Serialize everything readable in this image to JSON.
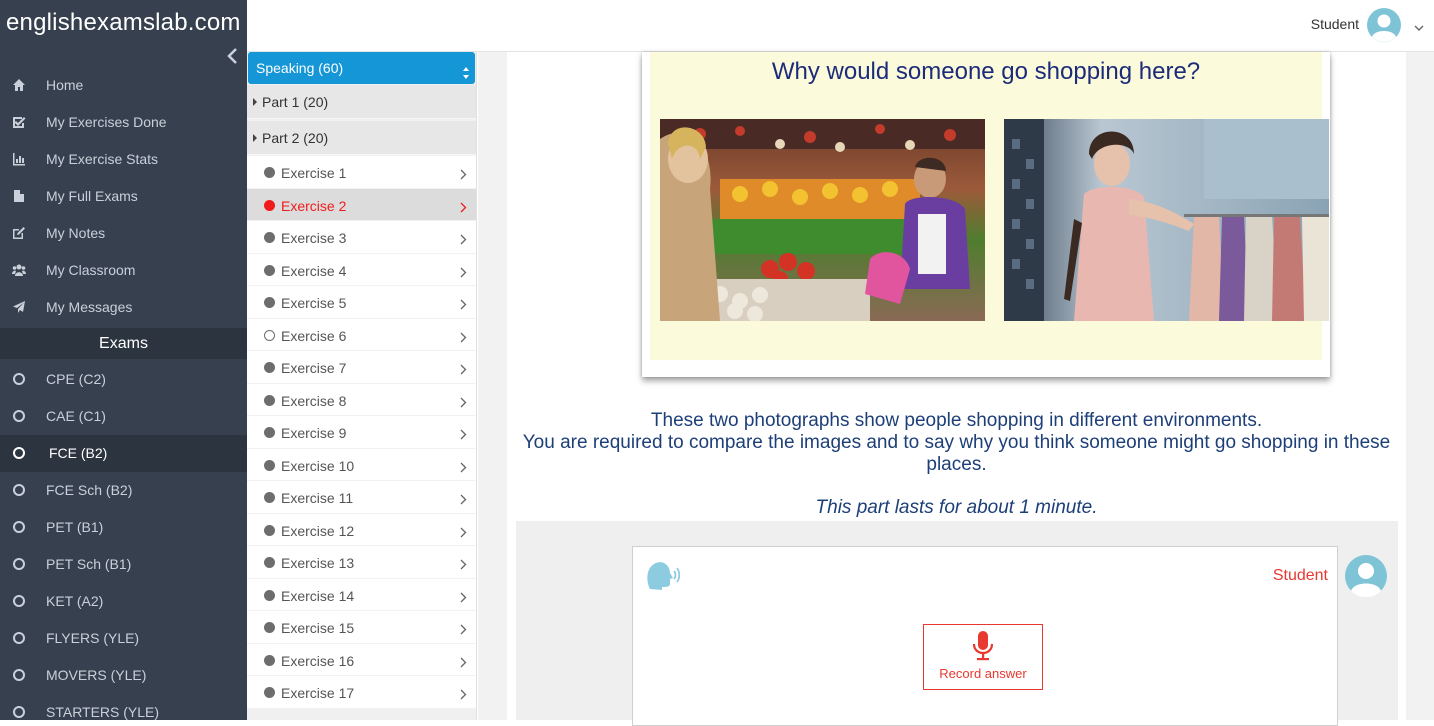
{
  "brand": {
    "logo_text": "englishexamslab.com"
  },
  "header": {
    "user_name": "Student"
  },
  "sidebar": {
    "items": [
      {
        "label": "Home",
        "icon": "home-icon"
      },
      {
        "label": "My Exercises Done",
        "icon": "check-square-icon"
      },
      {
        "label": "My Exercise Stats",
        "icon": "bar-chart-icon"
      },
      {
        "label": "My Full Exams",
        "icon": "file-icon"
      },
      {
        "label": "My Notes",
        "icon": "edit-icon"
      },
      {
        "label": "My Classroom",
        "icon": "users-icon"
      },
      {
        "label": "My Messages",
        "icon": "paper-plane-icon"
      }
    ],
    "exams_heading": "Exams",
    "exams": [
      {
        "label": "CPE (C2)",
        "active": false
      },
      {
        "label": "CAE (C1)",
        "active": false
      },
      {
        "label": "FCE (B2)",
        "active": true
      },
      {
        "label": "FCE Sch (B2)",
        "active": false
      },
      {
        "label": "PET (B1)",
        "active": false
      },
      {
        "label": "PET Sch (B1)",
        "active": false
      },
      {
        "label": "KET (A2)",
        "active": false
      },
      {
        "label": "FLYERS (YLE)",
        "active": false
      },
      {
        "label": "MOVERS (YLE)",
        "active": false
      },
      {
        "label": "STARTERS (YLE)",
        "active": false
      }
    ]
  },
  "panel": {
    "section_select": "Speaking (60)",
    "parts": [
      "Part 1 (20)",
      "Part 2 (20)"
    ],
    "exercises": [
      {
        "label": "Exercise 1",
        "status": "done",
        "active": false
      },
      {
        "label": "Exercise 2",
        "status": "current",
        "active": true
      },
      {
        "label": "Exercise 3",
        "status": "done",
        "active": false
      },
      {
        "label": "Exercise 4",
        "status": "done",
        "active": false
      },
      {
        "label": "Exercise 5",
        "status": "done",
        "active": false
      },
      {
        "label": "Exercise 6",
        "status": "empty",
        "active": false
      },
      {
        "label": "Exercise 7",
        "status": "done",
        "active": false
      },
      {
        "label": "Exercise 8",
        "status": "done",
        "active": false
      },
      {
        "label": "Exercise 9",
        "status": "done",
        "active": false
      },
      {
        "label": "Exercise 10",
        "status": "done",
        "active": false
      },
      {
        "label": "Exercise 11",
        "status": "done",
        "active": false
      },
      {
        "label": "Exercise 12",
        "status": "done",
        "active": false
      },
      {
        "label": "Exercise 13",
        "status": "done",
        "active": false
      },
      {
        "label": "Exercise 14",
        "status": "done",
        "active": false
      },
      {
        "label": "Exercise 15",
        "status": "done",
        "active": false
      },
      {
        "label": "Exercise 16",
        "status": "done",
        "active": false
      },
      {
        "label": "Exercise 17",
        "status": "done",
        "active": false
      }
    ]
  },
  "main": {
    "figure_question": "Why would someone go shopping here?",
    "photos": [
      "market-stall-photo",
      "clothes-shop-photo"
    ],
    "instruction_lines": [
      "These two photographs show people shopping in different environments.",
      "You are required to compare the images and to say why you think someone might go shopping in these places."
    ],
    "duration": "This part lasts for about 1 minute.",
    "answer": {
      "student_label": "Student",
      "record_label": "Record answer"
    }
  },
  "colors": {
    "sidebar_bg": "#36404f",
    "accent_blue": "#1596d6",
    "active_red": "#f01c1c",
    "record_red": "#e8382f",
    "text_navy": "#1d3f78"
  }
}
